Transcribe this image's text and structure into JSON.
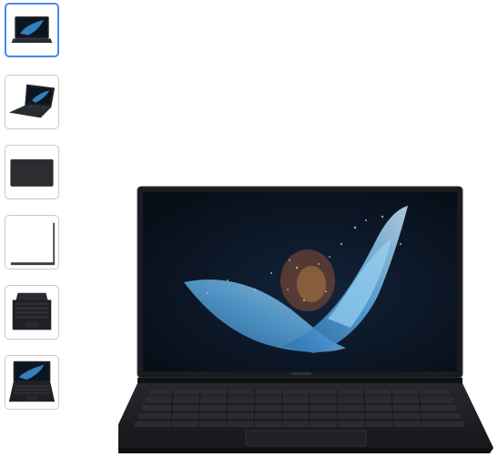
{
  "gallery": {
    "thumbnails": [
      {
        "view": "front-open",
        "selected": true
      },
      {
        "view": "angled-left",
        "selected": false
      },
      {
        "view": "closed-lid-top",
        "selected": false
      },
      {
        "view": "side-profile",
        "selected": false
      },
      {
        "view": "top-down-keyboard",
        "selected": false
      },
      {
        "view": "angled-front",
        "selected": false
      }
    ],
    "main_image": {
      "view": "front-open",
      "subject": "laptop"
    },
    "colors": {
      "selected_border": "#4a86f0",
      "thumb_border": "#c9c9c9",
      "laptop_body": "#1f2024",
      "screen_bg": "#0b1522",
      "wallpaper_accent": "#3d8fd6"
    }
  }
}
